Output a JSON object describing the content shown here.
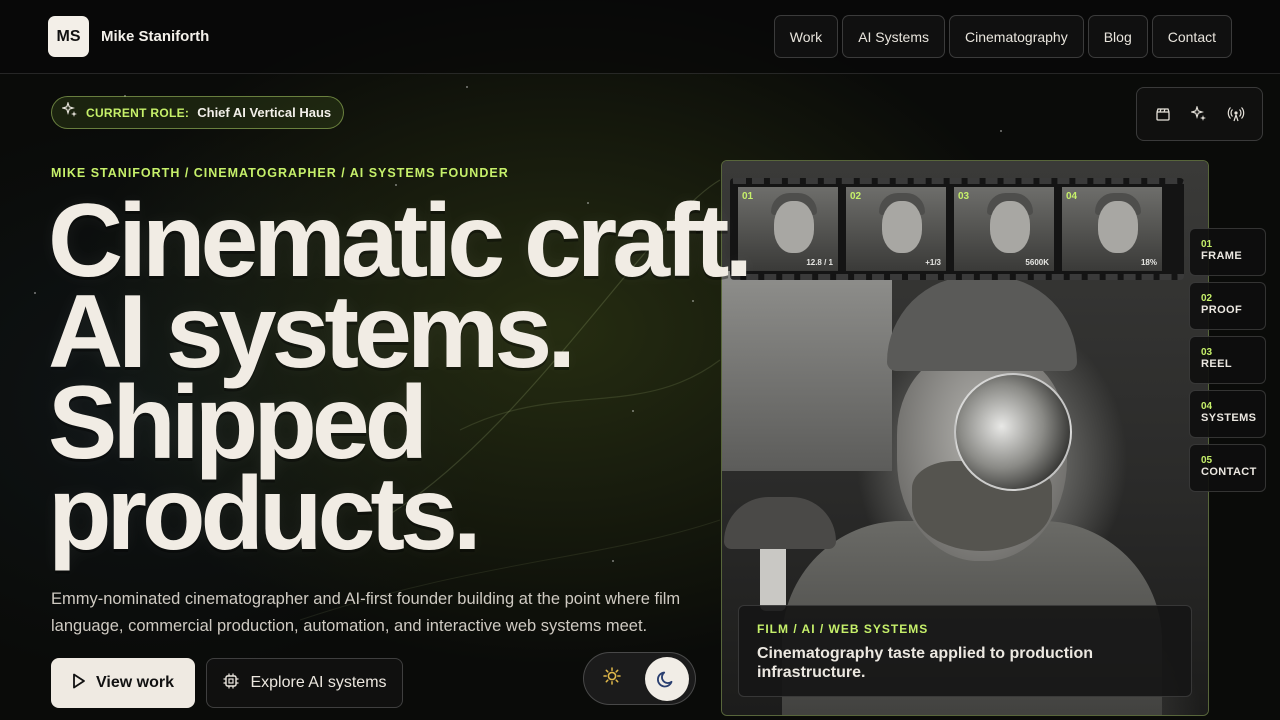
{
  "brand": {
    "initials": "MS",
    "name": "Mike Staniforth"
  },
  "nav": [
    {
      "label": "Work"
    },
    {
      "label": "AI Systems"
    },
    {
      "label": "Cinematography"
    },
    {
      "label": "Blog"
    },
    {
      "label": "Contact"
    }
  ],
  "role": {
    "key": "CURRENT ROLE:",
    "value": "Chief AI Vertical Haus"
  },
  "eyebrow": "MIKE STANIFORTH / CINEMATOGRAPHER / AI SYSTEMS FOUNDER",
  "headline": [
    "Cinematic craft.",
    "AI systems.",
    "Shipped",
    "products."
  ],
  "subtext": "Emmy-nominated cinematographer and AI-first founder building at the point where film language, commercial production, automation, and interactive web systems meet.",
  "buttons": {
    "primary": "View work",
    "secondary": "Explore AI systems"
  },
  "header_icons": [
    "clapperboard-icon",
    "sparkles-icon",
    "broadcast-icon"
  ],
  "film_strip": [
    {
      "num": "01",
      "meta": "12.8 / 1"
    },
    {
      "num": "02",
      "meta": "+1/3"
    },
    {
      "num": "03",
      "meta": "5600K"
    },
    {
      "num": "04",
      "meta": "18%"
    }
  ],
  "caption": {
    "tag": "FILM / AI / WEB SYSTEMS",
    "title": "Cinematography taste applied to production infrastructure."
  },
  "rail": [
    {
      "num": "01",
      "label": "FRAME"
    },
    {
      "num": "02",
      "label": "PROOF"
    },
    {
      "num": "03",
      "label": "REEL"
    },
    {
      "num": "04",
      "label": "SYSTEMS"
    },
    {
      "num": "05",
      "label": "CONTACT"
    }
  ],
  "theme": {
    "active": "dark"
  },
  "colors": {
    "accent": "#c6f06a",
    "text": "#f1ece4",
    "background": "#0a0b09"
  }
}
